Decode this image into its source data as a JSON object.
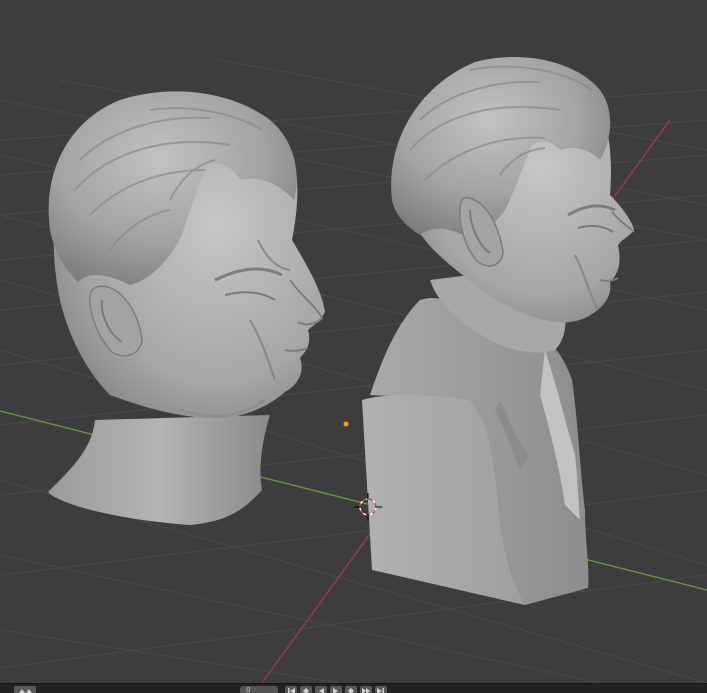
{
  "viewport": {
    "name": "3D Viewport",
    "objects": [
      {
        "name": "head"
      },
      {
        "name": "bust"
      }
    ]
  },
  "timeline": {
    "current_frame": "0",
    "buttons": [
      {
        "id": "editor-type",
        "icon": "editor-type-icon"
      },
      {
        "id": "jump-start",
        "icon": "jump-to-start-icon"
      },
      {
        "id": "prev-keyframe",
        "icon": "previous-keyframe-icon"
      },
      {
        "id": "play-reverse",
        "icon": "play-reverse-icon"
      },
      {
        "id": "play",
        "icon": "play-icon"
      },
      {
        "id": "next-keyframe",
        "icon": "next-keyframe-icon"
      },
      {
        "id": "jump-end",
        "icon": "jump-to-end-icon"
      }
    ]
  },
  "colors": {
    "background": "#3d3d3d",
    "grid": "#4a4a4a",
    "x_axis": "#a63a45",
    "y_axis": "#6b9c3a",
    "mesh": "#a7a7a7",
    "origin": "#f39a1e"
  }
}
